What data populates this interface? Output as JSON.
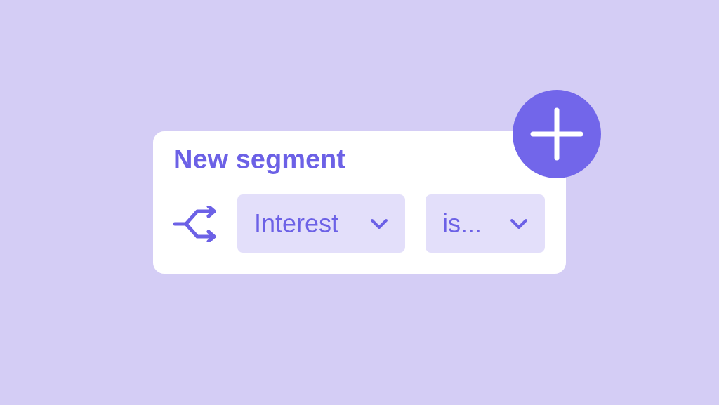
{
  "card": {
    "title": "New segment",
    "dropdowns": [
      {
        "value": "Interest"
      },
      {
        "value": "is..."
      }
    ]
  }
}
